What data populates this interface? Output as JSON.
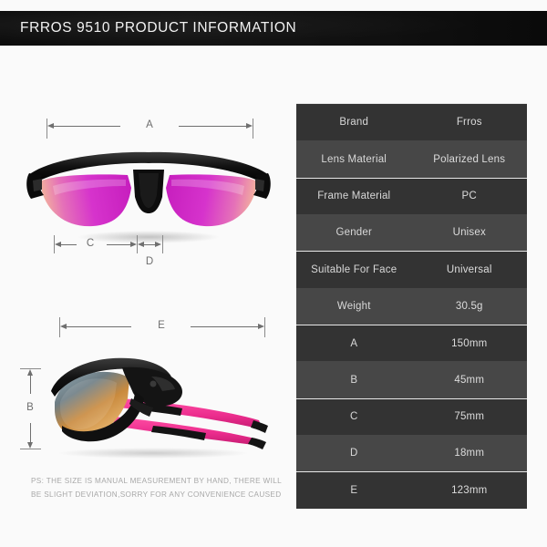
{
  "header": {
    "title": "FRROS  9510 PRODUCT INFORMATION"
  },
  "product_views": {
    "front": {
      "caption_dimensions": [
        "A",
        "C",
        "D"
      ],
      "frame_color": "#141414",
      "lens_color": "#d633cc",
      "lens_edge_color": "#f0a38c"
    },
    "side": {
      "caption_dimensions": [
        "E",
        "B"
      ],
      "frame_color": "#161616",
      "temple_color": "#ec2d8e",
      "lens_color": "#d98a3a"
    }
  },
  "dimension_labels": {
    "a": "A",
    "b": "B",
    "c": "C",
    "d": "D",
    "e": "E"
  },
  "footnote": {
    "line1": "PS: THE SIZE IS MANUAL MEASUREMENT BY HAND, THERE WILL",
    "line2": "BE SLIGHT DEVIATION,SORRY FOR ANY CONVENIENCE CAUSED"
  },
  "spec_table": {
    "rows": [
      {
        "key": "Brand",
        "value": "Frros"
      },
      {
        "key": "Lens Material",
        "value": "Polarized Lens"
      },
      {
        "key": "Frame Material",
        "value": "PC"
      },
      {
        "key": "Gender",
        "value": "Unisex"
      },
      {
        "key": "Suitable For Face",
        "value": "Universal"
      },
      {
        "key": "Weight",
        "value": "30.5g"
      },
      {
        "key": "A",
        "value": "150mm"
      },
      {
        "key": "B",
        "value": "45mm"
      },
      {
        "key": "C",
        "value": "75mm"
      },
      {
        "key": "D",
        "value": "18mm"
      },
      {
        "key": "E",
        "value": "123mm"
      }
    ]
  },
  "colors": {
    "background": "#fafafa",
    "banner": "#101010",
    "row_dark": "#333333",
    "row_light": "#474747",
    "separator": "#e8e8e8",
    "dimension_line": "#6f6f6f"
  }
}
